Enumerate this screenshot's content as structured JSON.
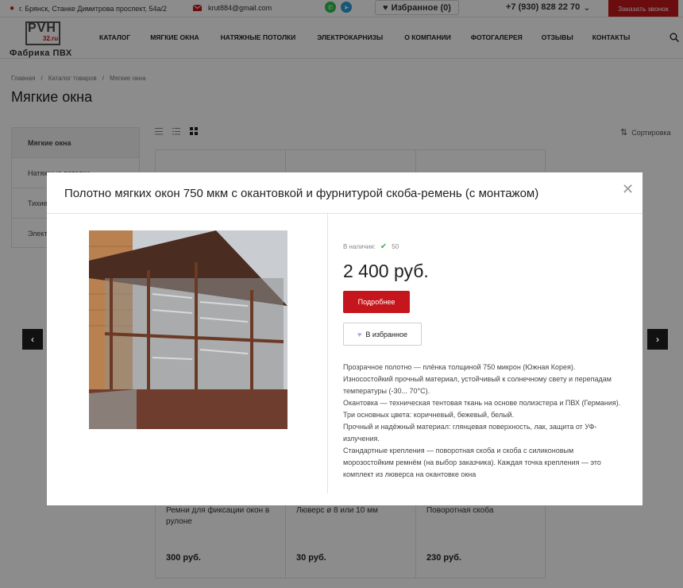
{
  "topbar": {
    "address": "г. Брянск, Станке Димитрова проспект, 54а/2",
    "email": "krut884@gmail.com",
    "favorites_label": "Избранное (0)",
    "phone": "+7 (930) 828 22 70",
    "callback_label": "Заказать звонок"
  },
  "logo": {
    "mark_text": "PVH",
    "mark_domain": "32.ru",
    "name": "Фабрика ПВХ"
  },
  "nav": [
    "КАТАЛОГ",
    "МЯГКИЕ ОКНА",
    "НАТЯЖНЫЕ ПОТОЛКИ",
    "ЭЛЕКТРОКАРНИЗЫ",
    "О КОМПАНИИ",
    "ФОТОГАЛЕРЕЯ",
    "ОТЗЫВЫ",
    "КОНТАКТЫ"
  ],
  "breadcrumbs": [
    "Главная",
    "Каталог товаров",
    "Мягкие окна"
  ],
  "page_title": "Мягкие окна",
  "sidebar": [
    "Мягкие окна",
    "Натяжные потолки",
    "Тихие",
    "Элект"
  ],
  "sort_label": "Сортировка",
  "products": [
    {
      "name": "Ремни для фиксации окон в рулоне",
      "price": "300 руб."
    },
    {
      "name": "Люверс ø 8 или 10 мм",
      "price": "30 руб."
    },
    {
      "name": "Поворотная скоба",
      "price": "230 руб."
    }
  ],
  "modal": {
    "title": "Полотно мягких окон 750 мкм с окантовкой и фурнитурой скоба-ремень (с монтажом)",
    "stock_label": "В наличии:",
    "stock_count": "50",
    "price": "2 400 руб.",
    "more_label": "Подробнее",
    "favorite_label": "В избранное",
    "description": [
      "Прозрачное полотно — плёнка толщиной 750 микрон (Южная Корея).",
      "Износостойкий прочный материал, устойчивый к солнечному свету и перепадам температуры (-30... 70°С).",
      "Окантовка — техническая тентовая ткань на основе полиэстера и ПВХ (Германия).",
      "Три основных цвета: коричневый, бежевый, белый.",
      "Прочный и надёжный материал: глянцевая поверхность, лак, защита от УФ-излучения.",
      "Стандартные крепления — поворотная скоба и скоба с силиконовым морозостойким ремнём (на выбор заказчика). Каждая точка крепления — это комплект из люверса на окантовке окна"
    ]
  },
  "colors": {
    "accent": "#c4161c",
    "whatsapp": "#2fbf4a",
    "telegram": "#2a9fd8",
    "overlay": "rgba(0,0,0,0.45)"
  }
}
